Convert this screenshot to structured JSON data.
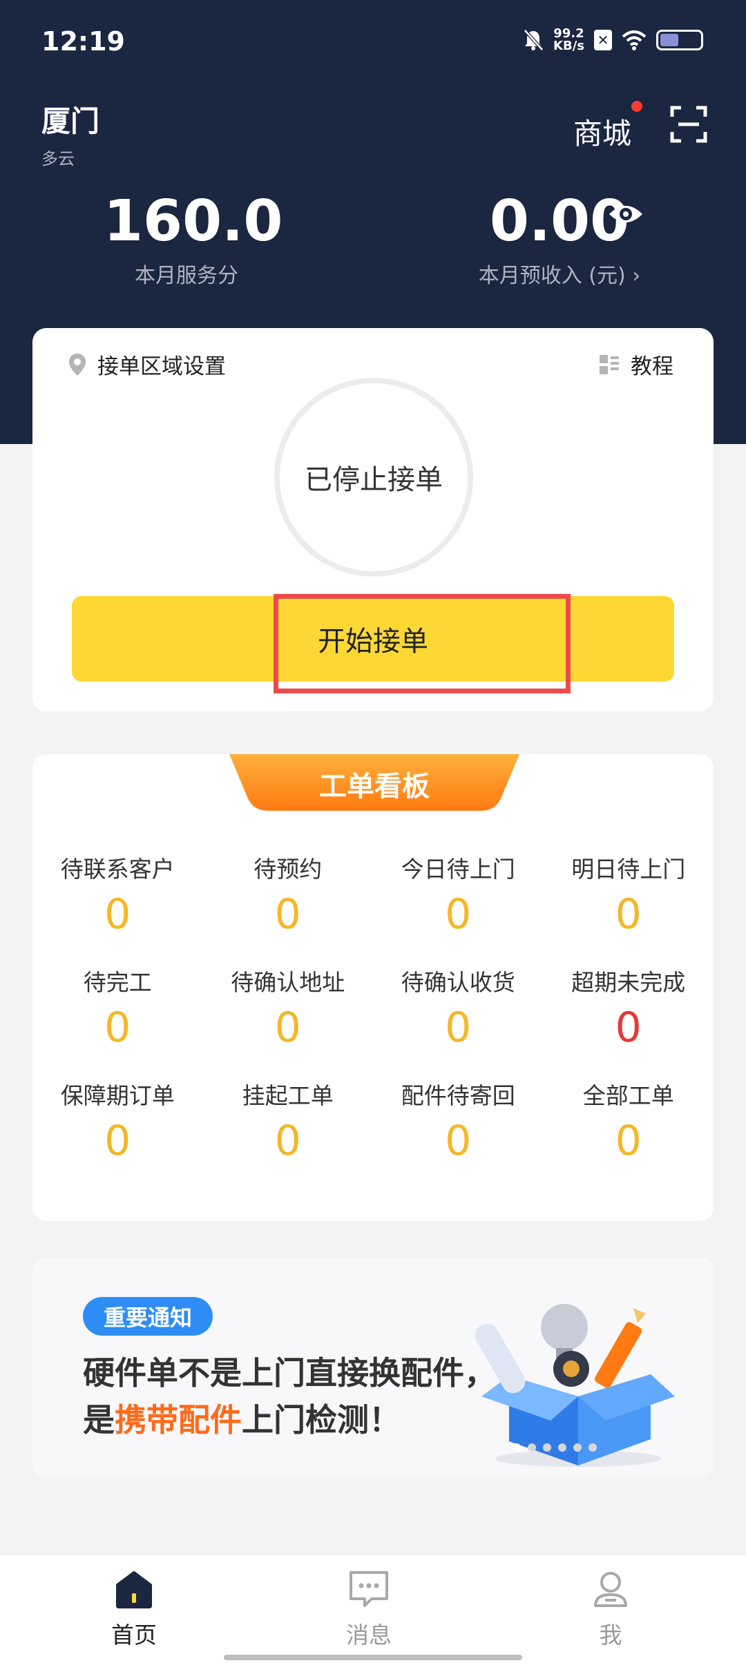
{
  "status_bar": {
    "time": "12:19",
    "net_speed_value": "99.2",
    "net_speed_unit": "KB/s"
  },
  "header": {
    "city": "厦门",
    "weather": "多云",
    "mall_label": "商城",
    "service_score": "160.0",
    "service_score_label": "本月服务分",
    "expected_income": "0.00",
    "expected_income_label": "本月预收入 (元)",
    "income_arrow": "›"
  },
  "order_card": {
    "area_setting_label": "接单区域设置",
    "tutorial_label": "教程",
    "status_text": "已停止接单",
    "start_button_label": "开始接单"
  },
  "board": {
    "title": "工单看板",
    "items": [
      {
        "label": "待联系客户",
        "value": "0"
      },
      {
        "label": "待预约",
        "value": "0"
      },
      {
        "label": "今日待上门",
        "value": "0"
      },
      {
        "label": "明日待上门",
        "value": "0"
      },
      {
        "label": "待完工",
        "value": "0"
      },
      {
        "label": "待确认地址",
        "value": "0"
      },
      {
        "label": "待确认收货",
        "value": "0"
      },
      {
        "label": "超期未完成",
        "value": "0"
      },
      {
        "label": "保障期订单",
        "value": "0"
      },
      {
        "label": "挂起工单",
        "value": "0"
      },
      {
        "label": "配件待寄回",
        "value": "0"
      },
      {
        "label": "全部工单",
        "value": "0"
      }
    ]
  },
  "banner": {
    "badge": "重要通知",
    "line1": "硬件单不是上门直接换配件，",
    "line2_prefix": "是",
    "line2_highlight": "携带配件",
    "line2_suffix": "上门检测！"
  },
  "nav": {
    "home": "首页",
    "messages": "消息",
    "me": "我"
  },
  "colors": {
    "header_bg": "#1b2640",
    "accent_yellow": "#fdd835",
    "count_yellow": "#f5b728",
    "alert_red": "#e53935",
    "highlight_orange": "#ff6a1a",
    "badge_blue": "#2e8df5"
  }
}
